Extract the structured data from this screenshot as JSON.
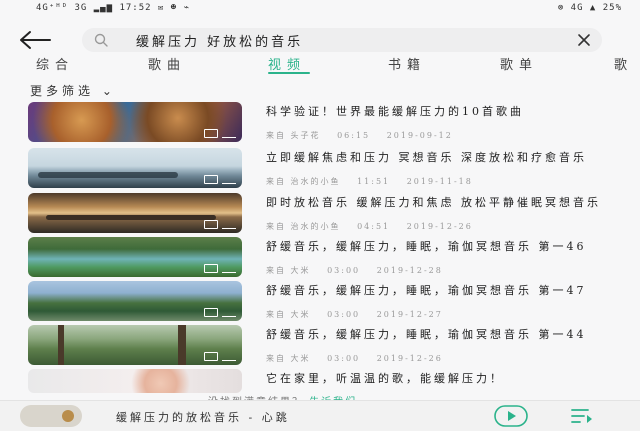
{
  "status_bar": {
    "left": "4G⁺ᴴᴰ 3G ▂▄▆ 17:52 ✉ ☻ ⌁",
    "right": "⊗  4G ▲ 25%"
  },
  "search": {
    "query": "缓解压力 好放松的音乐"
  },
  "tabs": [
    {
      "label": "综合"
    },
    {
      "label": "歌曲"
    },
    {
      "label": "视频"
    },
    {
      "label": "书籍"
    },
    {
      "label": "歌单"
    },
    {
      "label": "歌"
    }
  ],
  "filter": {
    "label": "更多筛选 ⌄"
  },
  "results": [
    {
      "title": "科学验证！世界最能缓解压力的10首歌曲",
      "source": "来自 头子花",
      "duration": "06:15",
      "date": "2019-09-12"
    },
    {
      "title": "立即缓解焦虑和压力 冥想音乐 深度放松和疗愈音乐",
      "source": "来自 治水的小鱼",
      "duration": "11:51",
      "date": "2019-11-18"
    },
    {
      "title": "即时放松音乐 缓解压力和焦虑 放松平静催眠冥想音乐",
      "source": "来自 治水的小鱼",
      "duration": "04:51",
      "date": "2019-12-26"
    },
    {
      "title": "舒缓音乐，缓解压力，睡眠，瑜伽冥想音乐 第一46",
      "source": "来自 大米",
      "duration": "03:00",
      "date": "2019-12-28"
    },
    {
      "title": "舒缓音乐，缓解压力，睡眠，瑜伽冥想音乐 第一47",
      "source": "来自 大米",
      "duration": "03:00",
      "date": "2019-12-27"
    },
    {
      "title": "舒缓音乐，缓解压力，睡眠，瑜伽冥想音乐 第一44",
      "source": "来自 大米",
      "duration": "03:00",
      "date": "2019-12-26"
    },
    {
      "title": "它在家里，听温温的歌，能缓解压力！",
      "source": "",
      "duration": "",
      "date": ""
    }
  ],
  "hint": {
    "text": "没找到满意结果？",
    "link": "告诉我们"
  },
  "player": {
    "title": "缓解压力的放松音乐 - 心跳"
  },
  "colors": {
    "accent": "#2bb38b",
    "background": "#f7f7f8"
  },
  "icons": {
    "back": "arrow-left-icon",
    "search": "search-icon",
    "clear": "close-icon",
    "play": "play-icon",
    "queue": "playlist-icon"
  }
}
